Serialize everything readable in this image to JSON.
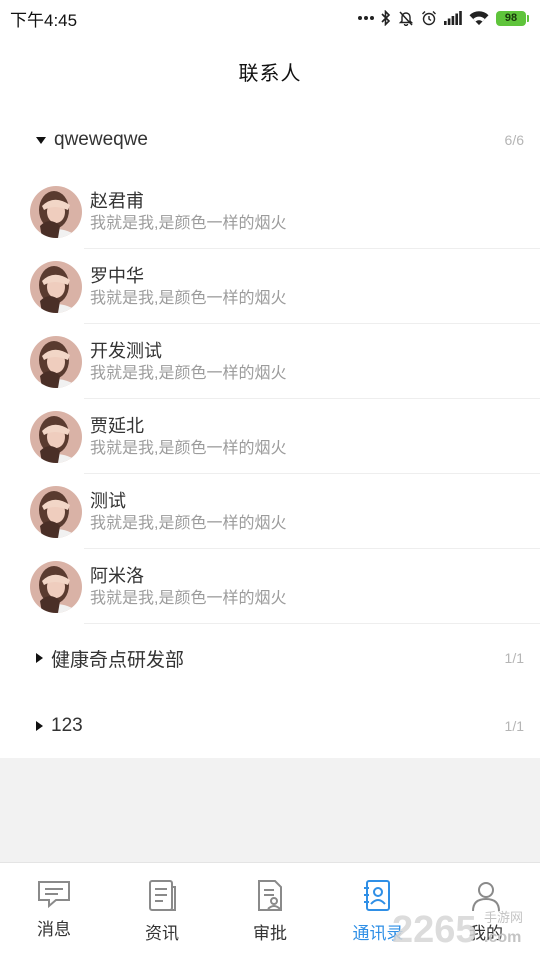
{
  "status_bar": {
    "time": "下午4:45",
    "battery": "98",
    "icons": [
      "more-dots-icon",
      "bluetooth-icon",
      "mute-icon",
      "alarm-icon",
      "signal-icon",
      "wifi-icon",
      "battery-icon"
    ]
  },
  "header": {
    "title": "联系人"
  },
  "groups": [
    {
      "name": "qweweqwe",
      "count": "6/6",
      "expanded": true,
      "contacts": [
        {
          "name": "赵君甫",
          "signature": "我就是我,是颜色一样的烟火"
        },
        {
          "name": "罗中华",
          "signature": "我就是我,是颜色一样的烟火"
        },
        {
          "name": "开发测试",
          "signature": "我就是我,是颜色一样的烟火"
        },
        {
          "name": "贾延北",
          "signature": "我就是我,是颜色一样的烟火"
        },
        {
          "name": "测试",
          "signature": "我就是我,是颜色一样的烟火"
        },
        {
          "name": "阿米洛",
          "signature": "我就是我,是颜色一样的烟火"
        }
      ]
    },
    {
      "name": "健康奇点研发部",
      "count": "1/1",
      "expanded": false
    },
    {
      "name": "123",
      "count": "1/1",
      "expanded": false
    }
  ],
  "tabbar": {
    "active": "通讯录",
    "accent_color": "#2f8fe6",
    "tabs": [
      {
        "label": "消息",
        "icon": "message-icon"
      },
      {
        "label": "资讯",
        "icon": "news-icon"
      },
      {
        "label": "审批",
        "icon": "approval-icon"
      },
      {
        "label": "通讯录",
        "icon": "contacts-icon"
      },
      {
        "label": "我的",
        "icon": "profile-icon"
      }
    ]
  },
  "watermark": {
    "text": "2265",
    "subtext": "手游网",
    "domain": ".com"
  }
}
